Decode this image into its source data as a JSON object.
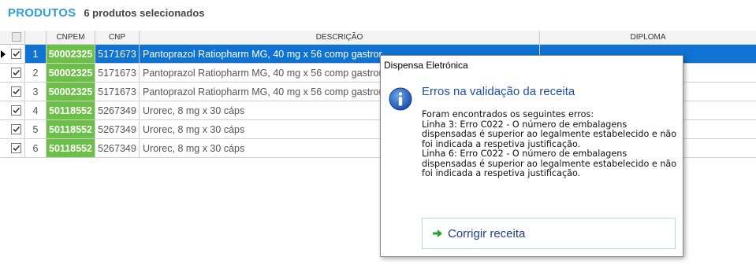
{
  "header": {
    "title": "PRODUTOS",
    "subtitle": "6 produtos selecionados"
  },
  "columns": {
    "cnpem": "CNPEM",
    "cnp": "CNP",
    "descricao": "DESCRIÇÃO",
    "diploma": "DIPLOMA"
  },
  "rows": [
    {
      "num": "1",
      "cnpem": "50002325",
      "cnp": "5171673",
      "descricao": "Pantoprazol Ratiopharm MG, 40 mg x 56 comp gastror",
      "checked": true,
      "selected": true
    },
    {
      "num": "2",
      "cnpem": "50002325",
      "cnp": "5171673",
      "descricao": "Pantoprazol Ratiopharm MG, 40 mg x 56 comp gastror",
      "checked": true,
      "selected": false
    },
    {
      "num": "3",
      "cnpem": "50002325",
      "cnp": "5171673",
      "descricao": "Pantoprazol Ratiopharm MG, 40 mg x 56 comp gastror",
      "checked": true,
      "selected": false
    },
    {
      "num": "4",
      "cnpem": "50118552",
      "cnp": "5267349",
      "descricao": "Urorec, 8 mg x 30 cáps",
      "checked": true,
      "selected": false
    },
    {
      "num": "5",
      "cnpem": "50118552",
      "cnp": "5267349",
      "descricao": "Urorec, 8 mg x 30 cáps",
      "checked": true,
      "selected": false
    },
    {
      "num": "6",
      "cnpem": "50118552",
      "cnp": "5267349",
      "descricao": "Urorec, 8 mg x 30 cáps",
      "checked": true,
      "selected": false
    }
  ],
  "dialog": {
    "window_title": "Dispensa Eletrónica",
    "heading": "Erros na validação da receita",
    "intro": "Foram encontrados os seguintes erros:",
    "errors": [
      "Linha 3: Erro C022 - O número de embalagens dispensadas é superior ao legalmente estabelecido e não foi indicada a respetiva justificação.",
      "Linha 6: Erro C022 - O número de embalagens dispensadas é superior ao legalmente estabelecido e não foi indicada a respetiva justificação."
    ],
    "action_label": "Corrigir receita",
    "icon": "info-icon"
  },
  "colors": {
    "accent": "#2d9fd8",
    "selected_row": "#0f73d4",
    "cnpem_bg": "#6cbf47",
    "dialog_heading": "#1e4fa8"
  }
}
